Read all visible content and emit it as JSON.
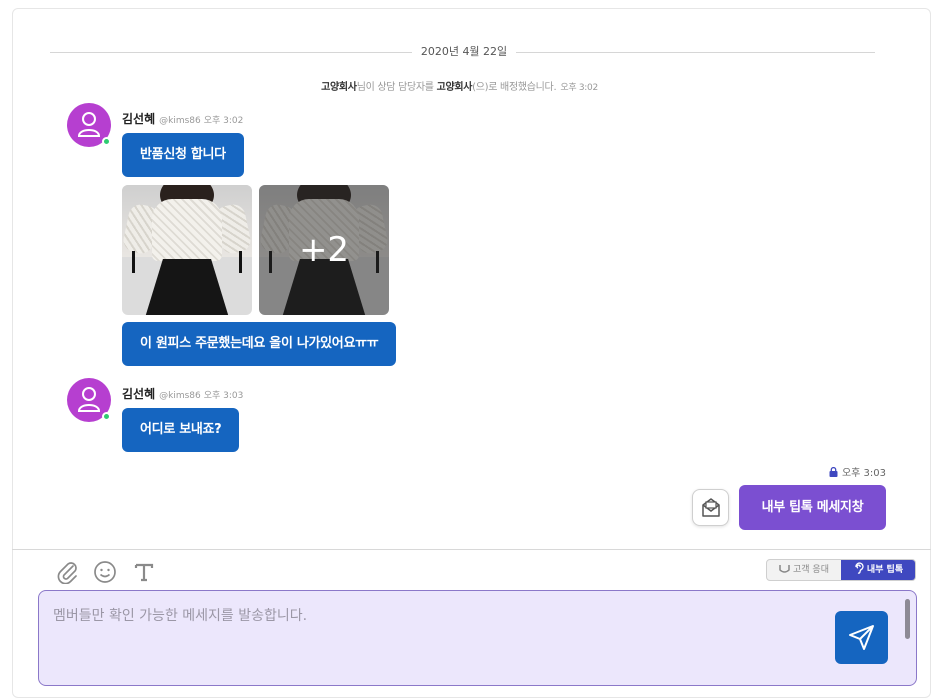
{
  "date_divider": "2020년 4월 22일",
  "system_message": {
    "company1": "고양회사",
    "text1": "님이 상담 담당자를 ",
    "company2": "고양회사",
    "text2": "(으)로 배정했습니다.",
    "time": "오후 3:02"
  },
  "messages": [
    {
      "sender": "김선혜",
      "handle": "@kims86",
      "time": "오후 3:02",
      "bubble1": "반품신청 합니다",
      "photo_more": "+2",
      "bubble2": "이 원피스 주문했는데요 올이 나가있어요ㅠㅠ"
    },
    {
      "sender": "김선혜",
      "handle": "@kims86",
      "time": "오후 3:03",
      "bubble1": "어디로 보내죠?"
    }
  ],
  "my_message": {
    "time": "오후 3:03",
    "text": "내부 팁톡 메세지창"
  },
  "toolbar": {
    "icons": [
      "paperclip-icon",
      "emoji-icon",
      "text-format-icon"
    ]
  },
  "mode_toggle": {
    "customer": "고객 응대",
    "internal": "내부 팁톡",
    "active": "internal"
  },
  "composer": {
    "placeholder": "멤버들만 확인 가능한 메세지를 발송합니다.",
    "value": ""
  },
  "colors": {
    "bubble": "#1565c0",
    "internal_bubble": "#7b4fd1",
    "avatar": "#b63fd0",
    "online": "#2ecc71",
    "composer_bg": "#ece7fc"
  }
}
